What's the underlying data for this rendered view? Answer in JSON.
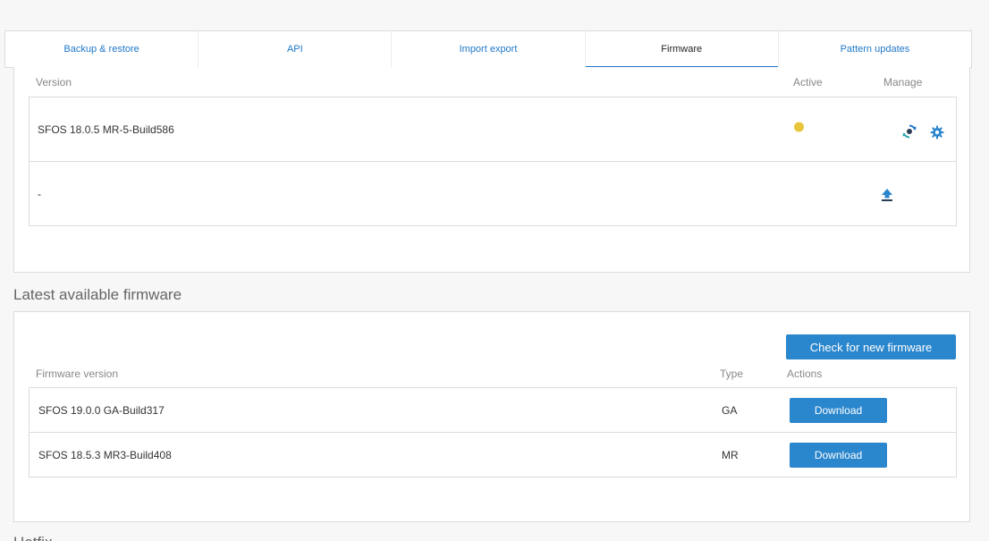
{
  "tabs": [
    {
      "label": "Backup & restore",
      "active": false
    },
    {
      "label": "API",
      "active": false
    },
    {
      "label": "Import export",
      "active": false
    },
    {
      "label": "Firmware",
      "active": true
    },
    {
      "label": "Pattern updates",
      "active": false
    }
  ],
  "installed": {
    "col_version": "Version",
    "col_active": "Active",
    "col_manage": "Manage",
    "rows": [
      {
        "version": "SFOS 18.0.5 MR-5-Build586",
        "active": true
      },
      {
        "version": "-",
        "active": false
      }
    ]
  },
  "latest": {
    "title": "Latest available firmware",
    "check_button": "Check for new firmware",
    "col_version": "Firmware version",
    "col_type": "Type",
    "col_actions": "Actions",
    "rows": [
      {
        "version": "SFOS 19.0.0 GA-Build317",
        "type": "GA",
        "action": "Download"
      },
      {
        "version": "SFOS 18.5.3 MR3-Build408",
        "type": "MR",
        "action": "Download"
      }
    ]
  },
  "next_section_title": "Hotfix",
  "colors": {
    "accent": "#2a86cd",
    "active_dot": "#e8c53a"
  }
}
